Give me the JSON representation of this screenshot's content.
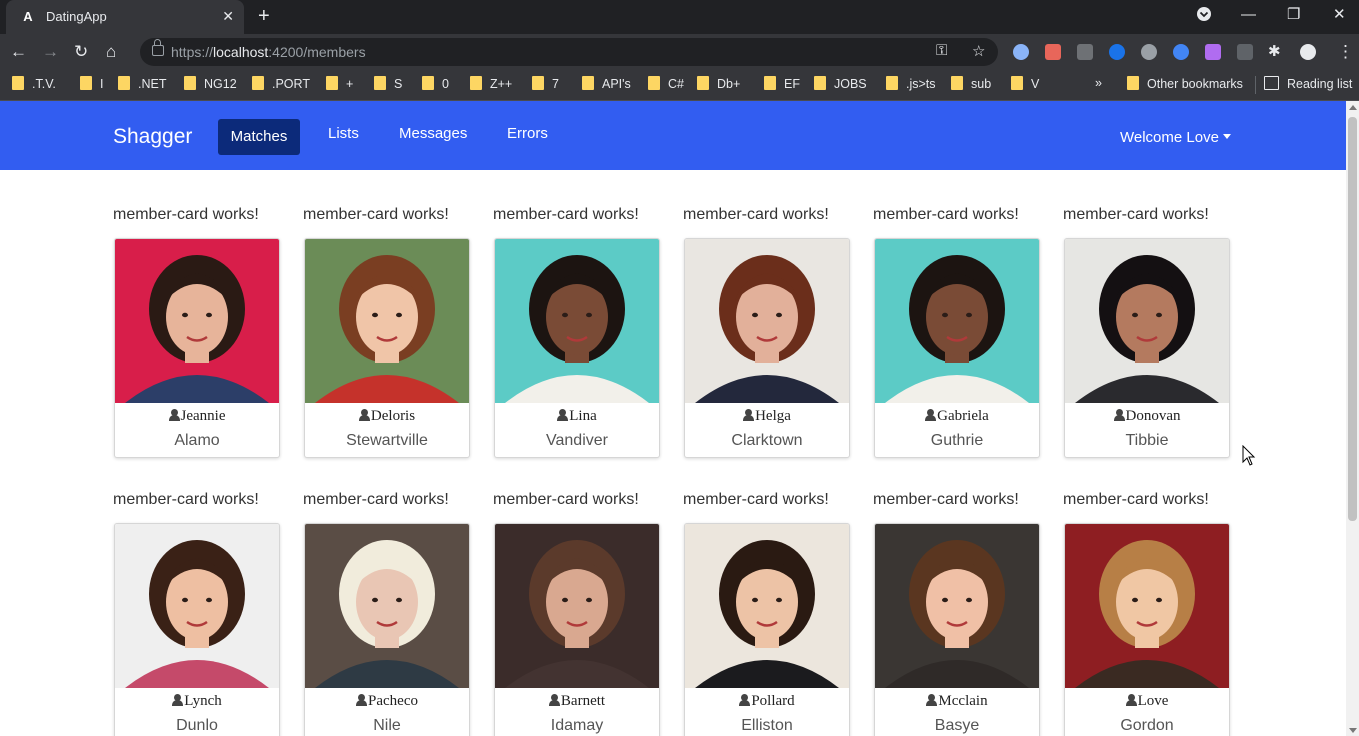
{
  "browser": {
    "tab_title": "DatingApp",
    "url_prefix": "https://",
    "url_host": "localhost",
    "url_path": ":4200/members",
    "bookmarks": [
      ".T.V.",
      "I",
      ".NET",
      "NG12",
      ".PORT",
      "+",
      "S",
      "0",
      "Z++",
      "7",
      "API's",
      "C#",
      "Db+",
      "EF",
      "JOBS",
      ".js>ts",
      "sub",
      "V"
    ],
    "overflow_label": "»",
    "other_bookmarks": "Other bookmarks",
    "reading_list": "Reading list"
  },
  "app": {
    "brand": "Shagger",
    "nav": [
      "Matches",
      "Lists",
      "Messages",
      "Errors"
    ],
    "active_nav": "Matches",
    "welcome": "Welcome Love"
  },
  "members": [
    {
      "works": "member-card works!",
      "name": "Jeannie",
      "city": "Alamo",
      "bg": "#d81e4a",
      "hair": "#2a1a14",
      "skin": "#e7b49a",
      "shirt": "#2c3e68"
    },
    {
      "works": "member-card works!",
      "name": "Deloris",
      "city": "Stewartville",
      "bg": "#6b8c57",
      "hair": "#7a3e22",
      "skin": "#f0c5a8",
      "shirt": "#c5322b"
    },
    {
      "works": "member-card works!",
      "name": "Lina",
      "city": "Vandiver",
      "bg": "#5ccbc6",
      "hair": "#1c1411",
      "skin": "#7a4b36",
      "shirt": "#f2f0ea"
    },
    {
      "works": "member-card works!",
      "name": "Helga",
      "city": "Clarktown",
      "bg": "#e9e6e1",
      "hair": "#6b2e1b",
      "skin": "#e2b09a",
      "shirt": "#23283c"
    },
    {
      "works": "member-card works!",
      "name": "Gabriela",
      "city": "Guthrie",
      "bg": "#5ccbc6",
      "hair": "#1c1411",
      "skin": "#7a4b36",
      "shirt": "#f2f0ea"
    },
    {
      "works": "member-card works!",
      "name": "Donovan",
      "city": "Tibbie",
      "bg": "#e6e6e3",
      "hair": "#141012",
      "skin": "#b47a5f",
      "shirt": "#2a2a2e"
    },
    {
      "works": "member-card works!",
      "name": "Lynch",
      "city": "Dunlo",
      "bg": "#efefef",
      "hair": "#3a2116",
      "skin": "#eebfa2",
      "shirt": "#c54a6a"
    },
    {
      "works": "member-card works!",
      "name": "Pacheco",
      "city": "Nile",
      "bg": "#5a4d45",
      "hair": "#f1ecdc",
      "skin": "#e9c6b4",
      "shirt": "#2e3a44"
    },
    {
      "works": "member-card works!",
      "name": "Barnett",
      "city": "Idamay",
      "bg": "#3b2c2a",
      "hair": "#5b3a2b",
      "skin": "#d9a890",
      "shirt": "#433331"
    },
    {
      "works": "member-card works!",
      "name": "Pollard",
      "city": "Elliston",
      "bg": "#ece6dd",
      "hair": "#2a1a12",
      "skin": "#edc3a6",
      "shirt": "#1b1b1e"
    },
    {
      "works": "member-card works!",
      "name": "Mcclain",
      "city": "Basye",
      "bg": "#3a3633",
      "hair": "#5a3620",
      "skin": "#f0c0a6",
      "shirt": "#2f2a28"
    },
    {
      "works": "member-card works!",
      "name": "Love",
      "city": "Gordon",
      "bg": "#8e1e22",
      "hair": "#b77f46",
      "skin": "#f0c7a4",
      "shirt": "#3a2a22"
    }
  ]
}
